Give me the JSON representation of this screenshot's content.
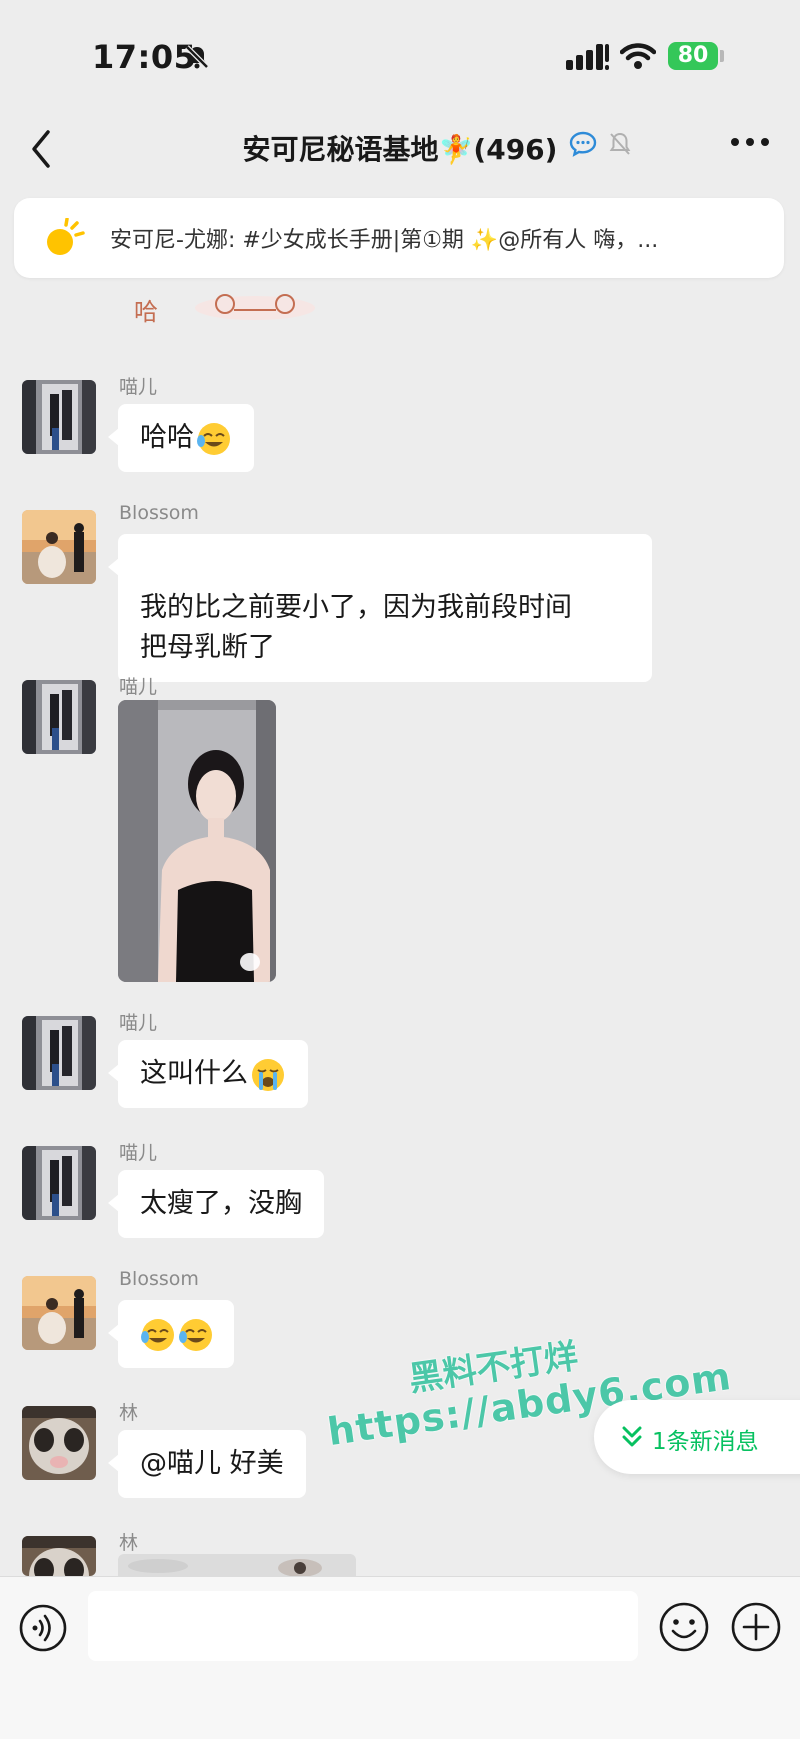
{
  "status": {
    "time": "17:05",
    "battery": "80"
  },
  "nav": {
    "title": "安可尼秘语基地🧚(496)"
  },
  "pinned": {
    "text": "安可尼-尤娜: #少女成长手册|第①期 ✨@所有人  嗨，..."
  },
  "messages": [
    {
      "sender": "喵儿",
      "text": "哈哈"
    },
    {
      "sender": "Blossom",
      "text": "我的比之前要小了，因为我前段时间\n把母乳断了"
    },
    {
      "sender": "喵儿"
    },
    {
      "sender": "喵儿",
      "text": "这叫什么"
    },
    {
      "sender": "喵儿",
      "text": "太瘦了，没胸"
    },
    {
      "sender": "Blossom",
      "text": ""
    },
    {
      "sender": "林",
      "text": "@喵儿 好美"
    },
    {
      "sender": "林"
    }
  ],
  "new_messages": {
    "label": "1条新消息"
  },
  "watermark": {
    "line1": "黑料不打烊",
    "line2": "https://abdy6.com"
  },
  "input": {
    "placeholder": ""
  },
  "colors": {
    "accent": "#07c160",
    "background": "#ededed",
    "bubble": "#ffffff",
    "battery": "#34c759"
  },
  "icons": [
    "mute-icon",
    "signal-icon",
    "wifi-icon",
    "back-icon",
    "chat-bubble-icon",
    "bell-off-icon",
    "more-icon",
    "sun-icon",
    "voice-icon",
    "emoji-icon",
    "plus-icon",
    "chevron-double-down-icon"
  ]
}
